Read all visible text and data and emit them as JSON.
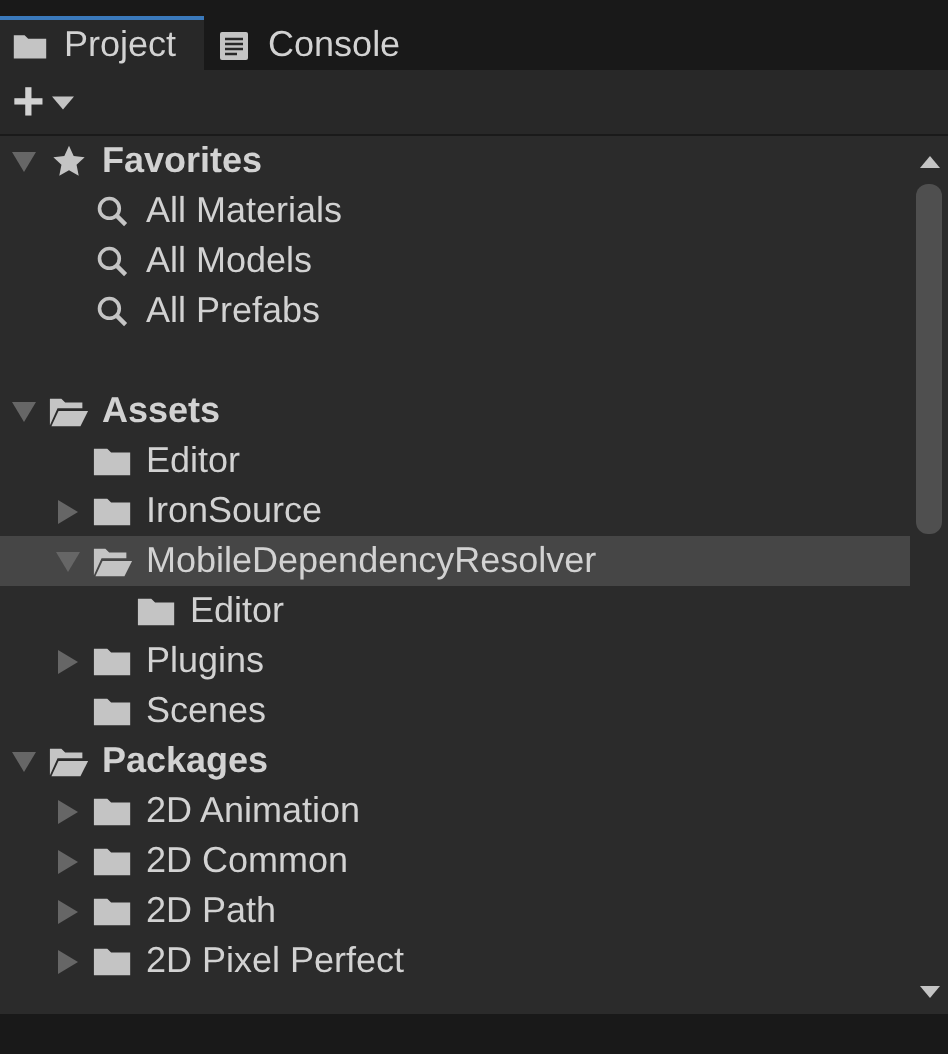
{
  "tabs": [
    {
      "label": "Project",
      "kind": "folder",
      "selected": true
    },
    {
      "label": "Console",
      "kind": "console",
      "selected": false
    }
  ],
  "toolbar": {
    "add_button": "+"
  },
  "tree": [
    {
      "label": "Favorites",
      "kind": "star",
      "expandable": true,
      "expanded": true,
      "selected": false,
      "children": [
        {
          "label": "All Materials",
          "kind": "search",
          "expandable": false,
          "expanded": false,
          "selected": false
        },
        {
          "label": "All Models",
          "kind": "search",
          "expandable": false,
          "expanded": false,
          "selected": false
        },
        {
          "label": "All Prefabs",
          "kind": "search",
          "expandable": false,
          "expanded": false,
          "selected": false
        }
      ]
    },
    {
      "label": "Assets",
      "kind": "folder",
      "expandable": true,
      "expanded": true,
      "selected": false,
      "children": [
        {
          "label": "Editor",
          "kind": "folder",
          "expandable": false,
          "expanded": false,
          "selected": false
        },
        {
          "label": "IronSource",
          "kind": "folder",
          "expandable": true,
          "expanded": false,
          "selected": false
        },
        {
          "label": "MobileDependencyResolver",
          "kind": "folder",
          "expandable": true,
          "expanded": true,
          "selected": true,
          "children": [
            {
              "label": "Editor",
              "kind": "folder",
              "expandable": false,
              "expanded": false,
              "selected": false
            }
          ]
        },
        {
          "label": "Plugins",
          "kind": "folder",
          "expandable": true,
          "expanded": false,
          "selected": false
        },
        {
          "label": "Scenes",
          "kind": "folder",
          "expandable": false,
          "expanded": false,
          "selected": false
        }
      ]
    },
    {
      "label": "Packages",
      "kind": "folder",
      "expandable": true,
      "expanded": true,
      "selected": false,
      "children": [
        {
          "label": "2D Animation",
          "kind": "folder",
          "expandable": true,
          "expanded": false,
          "selected": false
        },
        {
          "label": "2D Common",
          "kind": "folder",
          "expandable": true,
          "expanded": false,
          "selected": false
        },
        {
          "label": "2D Path",
          "kind": "folder",
          "expandable": true,
          "expanded": false,
          "selected": false
        },
        {
          "label": "2D Pixel Perfect",
          "kind": "folder",
          "expandable": true,
          "expanded": false,
          "selected": false
        }
      ]
    }
  ]
}
